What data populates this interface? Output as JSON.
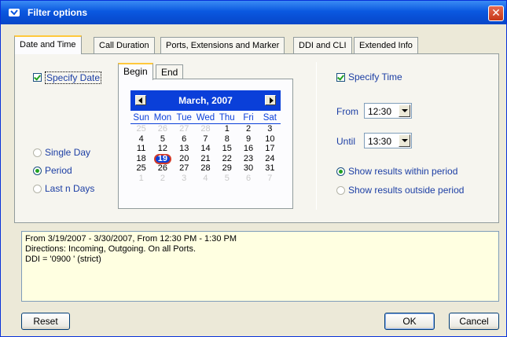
{
  "window": {
    "title": "Filter options",
    "close_label": "✕"
  },
  "tabs": [
    {
      "label": "Date and Time",
      "active": true
    },
    {
      "label": "Call Duration"
    },
    {
      "label": "Ports, Extensions and Marker"
    },
    {
      "label": "DDI and CLI"
    },
    {
      "label": "Extended Info"
    }
  ],
  "date": {
    "specify_date_label": "Specify Date",
    "specify_date_checked": true,
    "options": [
      {
        "label": "Single Day",
        "checked": false
      },
      {
        "label": "Period",
        "checked": true
      },
      {
        "label": "Last n Days",
        "checked": false
      }
    ],
    "inner_tabs": [
      {
        "label": "Begin",
        "active": true
      },
      {
        "label": "End"
      }
    ],
    "calendar": {
      "month_label": "March, 2007",
      "weekdays": [
        "Sun",
        "Mon",
        "Tue",
        "Wed",
        "Thu",
        "Fri",
        "Sat"
      ],
      "weeks": [
        [
          "25",
          "26",
          "27",
          "28",
          "1",
          "2",
          "3"
        ],
        [
          "4",
          "5",
          "6",
          "7",
          "8",
          "9",
          "10"
        ],
        [
          "11",
          "12",
          "13",
          "14",
          "15",
          "16",
          "17"
        ],
        [
          "18",
          "19",
          "20",
          "21",
          "22",
          "23",
          "24"
        ],
        [
          "25",
          "26",
          "27",
          "28",
          "29",
          "30",
          "31"
        ],
        [
          "1",
          "2",
          "3",
          "4",
          "5",
          "6",
          "7"
        ]
      ],
      "selected_day": "19"
    }
  },
  "time": {
    "specify_time_label": "Specify Time",
    "specify_time_checked": true,
    "from_label": "From",
    "from_value": "12:30",
    "until_label": "Until",
    "until_value": "13:30",
    "options": [
      {
        "label": "Show results within period",
        "checked": true
      },
      {
        "label": "Show results outside period",
        "checked": false
      }
    ]
  },
  "summary": {
    "lines": [
      "From 3/19/2007 - 3/30/2007, From 12:30 PM - 1:30 PM",
      "Directions: Incoming, Outgoing.  On all Ports.",
      "DDI = '0900 ' (strict)"
    ]
  },
  "buttons": {
    "reset": "Reset",
    "ok": "OK",
    "cancel": "Cancel"
  },
  "colors": {
    "title_bar": "#0a58e0",
    "calendar_header": "#0a3fd9",
    "summary_bg": "#ffffe1",
    "accent_label": "#1c3ea4"
  }
}
